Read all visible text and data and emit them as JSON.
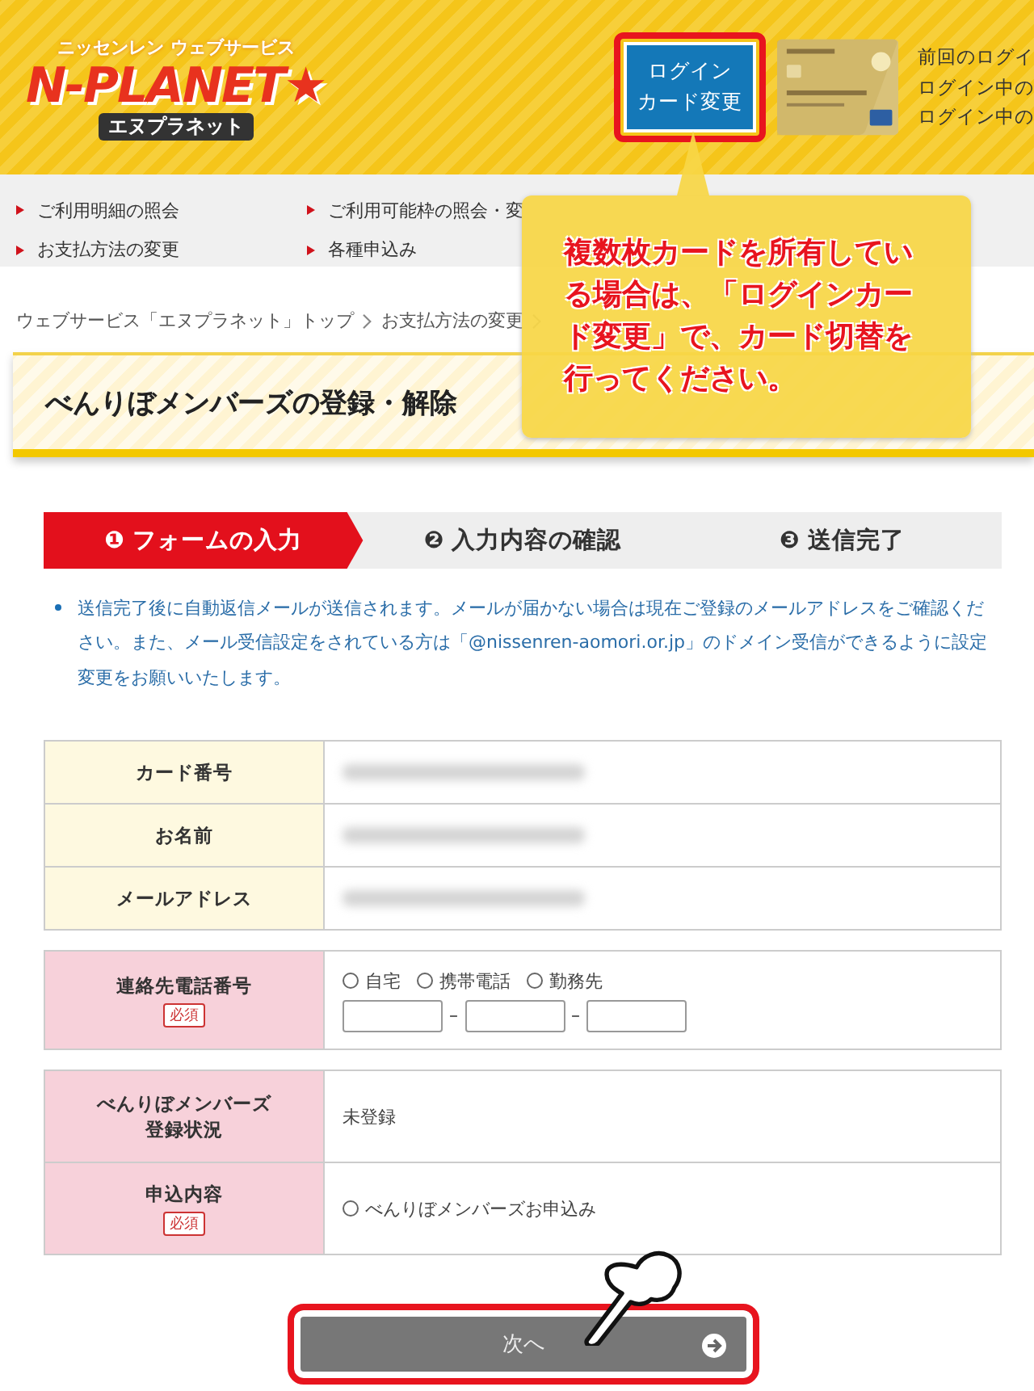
{
  "header": {
    "logo_tagline": "ニッセンレン ウェブサービス",
    "logo_main": "N-PLANET★",
    "logo_reading": "エヌプラネット",
    "login_button": [
      "ログイン",
      "カード変更"
    ],
    "info_lines": [
      "前回のログイ",
      "ログイン中の",
      "ログイン中の"
    ]
  },
  "nav": [
    {
      "label": "ご利用明細の照会"
    },
    {
      "label": "ご利用可能枠の照会・変"
    },
    {
      "label": "お支払方法の変更"
    },
    {
      "label": "各種申込み"
    }
  ],
  "breadcrumb": [
    "ウェブサービス「エヌプラネット」トップ",
    "お支払方法の変更"
  ],
  "page_title": "べんりぼメンバーズの登録・解除",
  "callout": "複数枚カードを所有している場合は、「ログインカード変更」で、カード切替を行ってください。",
  "steps": [
    {
      "number": "❶",
      "label": "フォームの入力",
      "selected": true
    },
    {
      "number": "❷",
      "label": "入力内容の確認",
      "selected": false
    },
    {
      "number": "❸",
      "label": "送信完了",
      "selected": false
    }
  ],
  "notice": "送信完了後に自動返信メールが送信されます。メールが届かない場合は現在ご登録のメールアドレスをご確認ください。また、メール受信設定をされている方は「@nissenren-aomori.or.jp」のドメイン受信ができるように設定変更をお願いいたします。",
  "info_table": [
    {
      "label": "カード番号",
      "redacted": true
    },
    {
      "label": "お名前",
      "redacted": true
    },
    {
      "label": "メールアドレス",
      "redacted": true
    }
  ],
  "phone": {
    "label": "連絡先電話番号",
    "required_badge": "必須",
    "options": [
      {
        "label": "自宅",
        "selected": false
      },
      {
        "label": "携帯電話",
        "selected": false
      },
      {
        "label": "勤務先",
        "selected": false
      }
    ],
    "separators": [
      "–",
      "–"
    ]
  },
  "membership": {
    "status_label": [
      "べんりぼメンバーズ",
      "登録状況"
    ],
    "status_value": "未登録",
    "apply_label": "申込内容",
    "required_badge": "必須",
    "options": [
      {
        "label": "べんりぼメンバーズお申込み",
        "selected": false
      }
    ]
  },
  "next_button": "次へ"
}
